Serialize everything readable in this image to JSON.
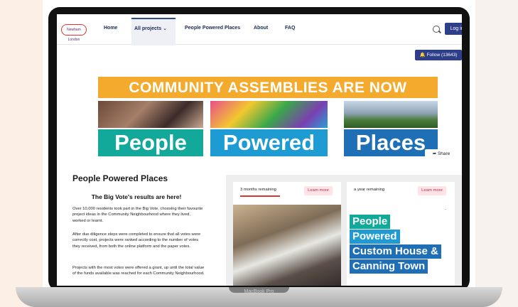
{
  "device": {
    "label": "MacBook Pro"
  },
  "nav": {
    "logo": "Newham London",
    "home": "Home",
    "all_projects": "All projects",
    "people_powered": "People Powered Places",
    "about": "About",
    "faq": "FAQ",
    "login": "Log in"
  },
  "follow": {
    "label": "Follow (13643)"
  },
  "banner": {
    "headline": "COMMUNITY ASSEMBLIES ARE NOW",
    "words": [
      "People",
      "Powered",
      "Places"
    ]
  },
  "share": {
    "label": "Share"
  },
  "content": {
    "title": "People Powered Places",
    "subtitle": "The Big Vote's results are here!",
    "paragraphs": [
      "Over 10,000 residents took part in the Big Vote, choosing their favourite project ideas in the Community Neighbourhood where they lived, worked or learnt.",
      "After due diligence steps were completed to ensure that all votes were correctly cost, projects were ranked according to the number of votes they received, from both the online platform and the paper votes.",
      "Projects with the most votes were offered a grant, up until the total value of the funds available was reached for each Community Neighbourhood."
    ]
  },
  "cards": [
    {
      "remaining": "3 months remaining",
      "learn": "Learn more"
    },
    {
      "remaining": "a year remaining",
      "learn": "Learn more",
      "tags": [
        "People",
        "Powered",
        "Custom House &",
        "Canning Town"
      ]
    }
  ]
}
